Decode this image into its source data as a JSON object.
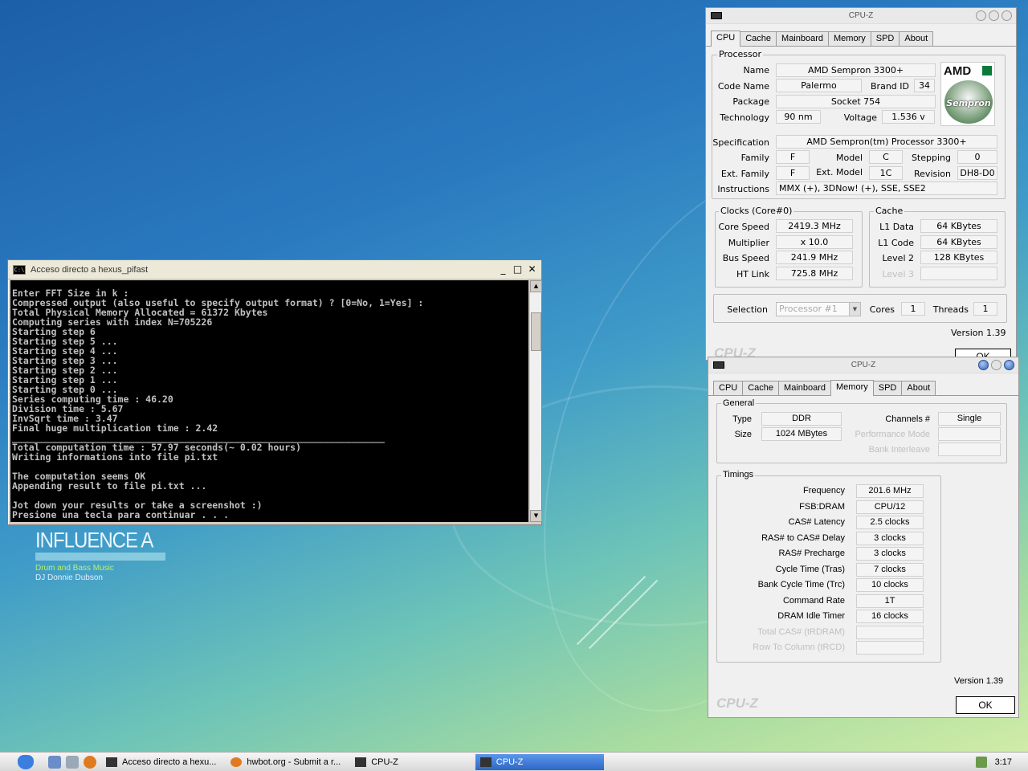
{
  "wallpaper": {
    "title": "INFLUENCE A",
    "line1": "Drum and Bass Music",
    "line2": "DJ Donnie Dubson"
  },
  "console": {
    "title": "Acceso directo a hexus_pifast",
    "icon": "console-icon",
    "buttons": [
      "_",
      "□",
      "✕"
    ],
    "output": "Enter FFT Size in k :\nCompressed output (also useful to specify output format) ? [0=No, 1=Yes] :\nTotal Physical Memory Allocated = 61372 Kbytes\nComputing series with index N=705226\nStarting step 6\nStarting step 5 ...\nStarting step 4 ...\nStarting step 3 ...\nStarting step 2 ...\nStarting step 1 ...\nStarting step 0 ...\nSeries computing time : 46.20\nDivision time : 5.67\nInvSqrt time : 3.47\nFinal huge multiplication time : 2.42\n___________________________________________________________________\nTotal computation time : 57.97 seconds(~ 0.02 hours)\nWriting informations into file pi.txt\n\nThe computation seems OK\nAppending result to file pi.txt ...\n\nJot down your results or take a screenshot :)\nPresione una tecla para continuar . . ."
  },
  "cpuz_back": {
    "title": "CPU-Z",
    "tabs": [
      "CPU",
      "Cache",
      "Mainboard",
      "Memory",
      "SPD",
      "About"
    ],
    "active_tab": "CPU",
    "processor": {
      "group": "Processor",
      "name_label": "Name",
      "name": "AMD Sempron 3300+",
      "codename_label": "Code Name",
      "codename": "Palermo",
      "brandid_label": "Brand ID",
      "brandid": "34",
      "package_label": "Package",
      "package": "Socket 754",
      "tech_label": "Technology",
      "tech": "90 nm",
      "voltage_label": "Voltage",
      "voltage": "1.536 v",
      "spec_label": "Specification",
      "spec": "AMD Sempron(tm) Processor 3300+",
      "family_label": "Family",
      "family": "F",
      "model_label": "Model",
      "model": "C",
      "stepping_label": "Stepping",
      "stepping": "0",
      "extfamily_label": "Ext. Family",
      "extfamily": "F",
      "extmodel_label": "Ext. Model",
      "extmodel": "1C",
      "revision_label": "Revision",
      "revision": "DH8-D0",
      "instr_label": "Instructions",
      "instr": "MMX (+), 3DNow! (+), SSE, SSE2",
      "logo_brand": "AMD",
      "logo_product": "Sempron"
    },
    "clocks": {
      "group": "Clocks (Core#0)",
      "core_label": "Core Speed",
      "core": "2419.3 MHz",
      "mult_label": "Multiplier",
      "mult": "x 10.0",
      "bus_label": "Bus Speed",
      "bus": "241.9 MHz",
      "ht_label": "HT Link",
      "ht": "725.8 MHz"
    },
    "cache": {
      "group": "Cache",
      "l1d_label": "L1 Data",
      "l1d": "64 KBytes",
      "l1c_label": "L1 Code",
      "l1c": "64 KBytes",
      "l2_label": "Level 2",
      "l2": "128 KBytes",
      "l3_label": "Level 3",
      "l3": ""
    },
    "selection_label": "Selection",
    "selection": "Processor #1",
    "cores_label": "Cores",
    "cores": "1",
    "threads_label": "Threads",
    "threads": "1",
    "version": "Version 1.39",
    "footer_logo": "CPU-Z",
    "ok": "OK"
  },
  "cpuz_front": {
    "title": "CPU-Z",
    "tabs": [
      "CPU",
      "Cache",
      "Mainboard",
      "Memory",
      "SPD",
      "About"
    ],
    "active_tab": "Memory",
    "general": {
      "group": "General",
      "type_label": "Type",
      "type": "DDR",
      "size_label": "Size",
      "size": "1024 MBytes",
      "channels_label": "Channels #",
      "channels": "Single",
      "perfmode_label": "Performance Mode",
      "perfmode": "",
      "bank_label": "Bank Interleave",
      "bank": ""
    },
    "timings": {
      "group": "Timings",
      "rows": [
        {
          "label": "Frequency",
          "value": "201.6 MHz",
          "dim": false
        },
        {
          "label": "FSB:DRAM",
          "value": "CPU/12",
          "dim": false
        },
        {
          "label": "CAS# Latency",
          "value": "2.5 clocks",
          "dim": false
        },
        {
          "label": "RAS# to CAS# Delay",
          "value": "3 clocks",
          "dim": false
        },
        {
          "label": "RAS# Precharge",
          "value": "3 clocks",
          "dim": false
        },
        {
          "label": "Cycle Time (Tras)",
          "value": "7 clocks",
          "dim": false
        },
        {
          "label": "Bank Cycle Time (Trc)",
          "value": "10 clocks",
          "dim": false
        },
        {
          "label": "Command Rate",
          "value": "1T",
          "dim": false
        },
        {
          "label": "DRAM Idle Timer",
          "value": "16 clocks",
          "dim": false
        },
        {
          "label": "Total CAS# (tRDRAM)",
          "value": "",
          "dim": true
        },
        {
          "label": "Row To Column (tRCD)",
          "value": "",
          "dim": true
        }
      ]
    },
    "version": "Version 1.39",
    "footer_logo": "CPU-Z",
    "ok": "OK"
  },
  "taskbar": {
    "tasks": [
      {
        "label": "Acceso directo a hexu...",
        "icon": "console-icon",
        "active": false
      },
      {
        "label": "hwbot.org - Submit a r...",
        "icon": "firefox-icon",
        "active": false
      },
      {
        "label": "CPU-Z",
        "icon": "cpuz-icon",
        "active": false
      },
      {
        "label": "CPU-Z",
        "icon": "cpuz-icon",
        "active": true
      }
    ],
    "clock": "3:17"
  },
  "colors": {
    "taskbar_active": "#2f67c6",
    "console_bg": "#000000",
    "console_fg": "#c0c0c0"
  }
}
